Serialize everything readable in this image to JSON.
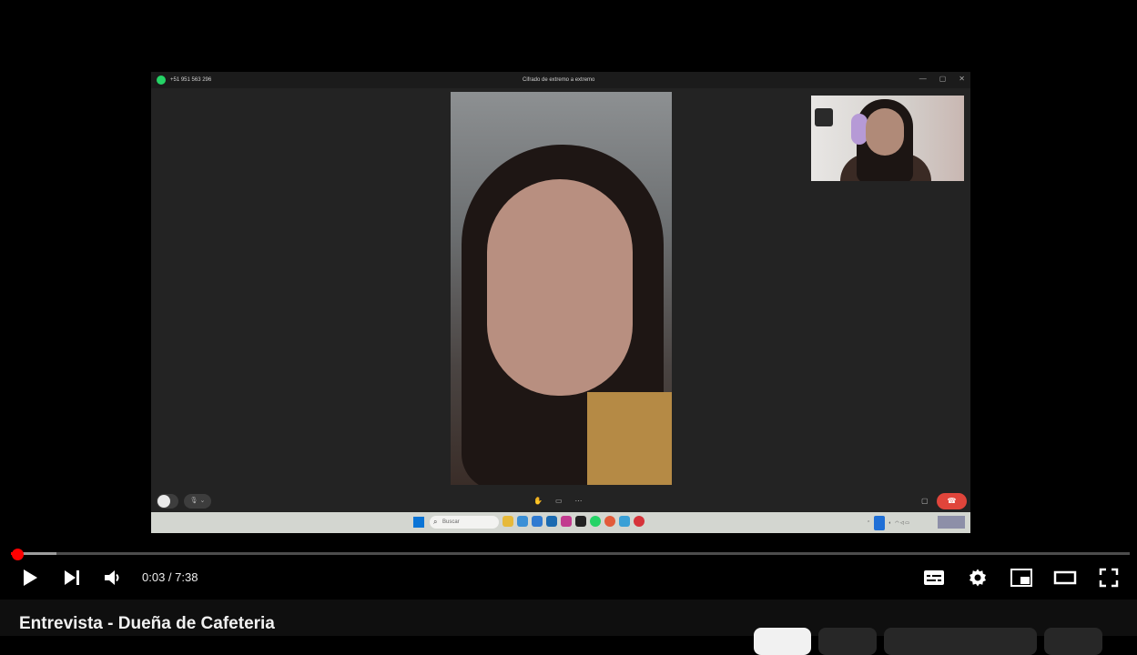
{
  "player": {
    "video": {
      "whatsapp_window": {
        "phone_number": "+51 951 563 296",
        "encryption_text": "Cifrado de extremo a extremo",
        "window_buttons": [
          "—",
          "▢",
          "✕"
        ],
        "search_placeholder": "Buscar"
      }
    },
    "progress": {
      "played_fraction": 0.007,
      "loaded_fraction": 0.041
    },
    "controls": {
      "current_time": "0:03",
      "duration": "7:38",
      "time_display": "0:03 / 7:38"
    }
  },
  "page": {
    "video_title": "Entrevista - Dueña de Cafeteria"
  },
  "colors": {
    "progress_red": "#ff0000",
    "end_call_red": "#e0453b",
    "whatsapp_green": "#25d366"
  },
  "icons": [
    "play-icon",
    "next-icon",
    "volume-icon",
    "subtitles-icon",
    "settings-icon",
    "miniplayer-icon",
    "theater-mode-icon",
    "fullscreen-icon"
  ]
}
